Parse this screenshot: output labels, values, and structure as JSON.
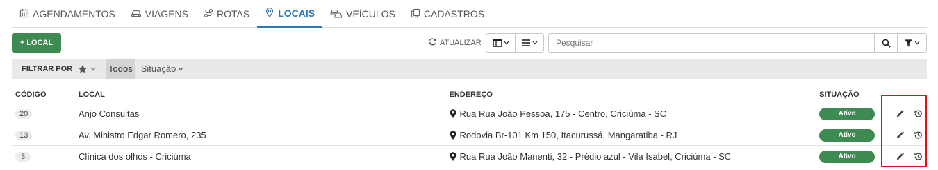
{
  "tabs": [
    {
      "label": "AGENDAMENTOS",
      "icon": "calendar-icon",
      "active": false
    },
    {
      "label": "VIAGENS",
      "icon": "car-icon",
      "active": false
    },
    {
      "label": "ROTAS",
      "icon": "route-icon",
      "active": false
    },
    {
      "label": "LOCAIS",
      "icon": "map-marker-icon",
      "active": true
    },
    {
      "label": "VEÍCULOS",
      "icon": "vehicles-icon",
      "active": false
    },
    {
      "label": "CADASTROS",
      "icon": "copy-icon",
      "active": false
    }
  ],
  "toolbar": {
    "add_label": "+ LOCAL",
    "refresh_label": "ATUALIZAR",
    "search_placeholder": "Pesquisar"
  },
  "filter": {
    "label": "FILTRAR POR",
    "todos": "Todos",
    "situacao": "Situação"
  },
  "table": {
    "headers": {
      "codigo": "CÓDIGO",
      "local": "LOCAL",
      "endereco": "ENDEREÇO",
      "situacao": "SITUAÇÃO"
    },
    "rows": [
      {
        "codigo": "20",
        "local": "Anjo Consultas",
        "endereco": "Rua Rua João Pessoa, 175 - Centro, Criciúma - SC",
        "situacao": "Ativo"
      },
      {
        "codigo": "13",
        "local": "Av. Ministro Edgar Romero, 235",
        "endereco": "Rodovia Br-101 Km 150, Itacurussá, Mangaratiba - RJ",
        "situacao": "Ativo"
      },
      {
        "codigo": "3",
        "local": "Clínica dos olhos - Criciúma",
        "endereco": "Rua Rua João Manenti, 32 - Prédio azul - Vila Isabel, Criciúma - SC",
        "situacao": "Ativo"
      }
    ]
  },
  "colors": {
    "accent": "#2a79b9",
    "success": "#3d8b52",
    "highlight": "#e0101a"
  }
}
